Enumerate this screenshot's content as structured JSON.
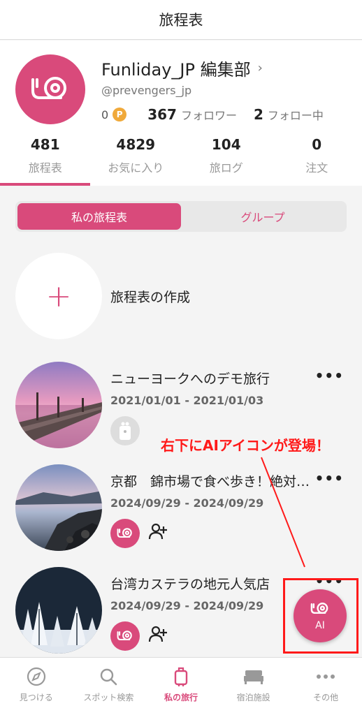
{
  "header": {
    "title": "旅程表"
  },
  "profile": {
    "name": "Funliday_JP 編集部",
    "chevron": "›",
    "handle": "@prevengers_jp",
    "points": "0",
    "coin_symbol": "P",
    "followers_count": "367",
    "followers_label": "フォロワー",
    "following_count": "2",
    "following_label": "フォロー中"
  },
  "tabs": [
    {
      "count": "481",
      "label": "旅程表"
    },
    {
      "count": "4829",
      "label": "お気に入り"
    },
    {
      "count": "104",
      "label": "旅ログ"
    },
    {
      "count": "0",
      "label": "注文"
    }
  ],
  "segment": {
    "mine": "私の旅程表",
    "group": "グループ"
  },
  "create": {
    "plus": "+",
    "label": "旅程表の作成"
  },
  "trips": [
    {
      "title": "ニューヨークへのデモ旅行",
      "dates": "2021/01/01 - 2021/01/03",
      "more": "•••"
    },
    {
      "title": "京都　錦市場で食べ歩き！絶対外…",
      "dates": "2024/09/29 - 2024/09/29",
      "more": "•••"
    },
    {
      "title": "台湾カステラの地元人気店",
      "dates": "2024/09/29 - 2024/09/29",
      "more": "•••"
    }
  ],
  "annotation": {
    "text": "右下にAIアイコンが登場！",
    "color": "#ff1a1a"
  },
  "ai_button": {
    "label": "AI"
  },
  "bottom_nav": [
    {
      "label": "見つける",
      "icon": "compass-icon"
    },
    {
      "label": "スポット検索",
      "icon": "search-icon"
    },
    {
      "label": "私の旅行",
      "icon": "suitcase-icon"
    },
    {
      "label": "宿泊施設",
      "icon": "bed-icon"
    },
    {
      "label": "その他",
      "icon": "more-icon"
    }
  ],
  "colors": {
    "accent": "#d94a7b",
    "annotation": "#ff1a1a"
  }
}
